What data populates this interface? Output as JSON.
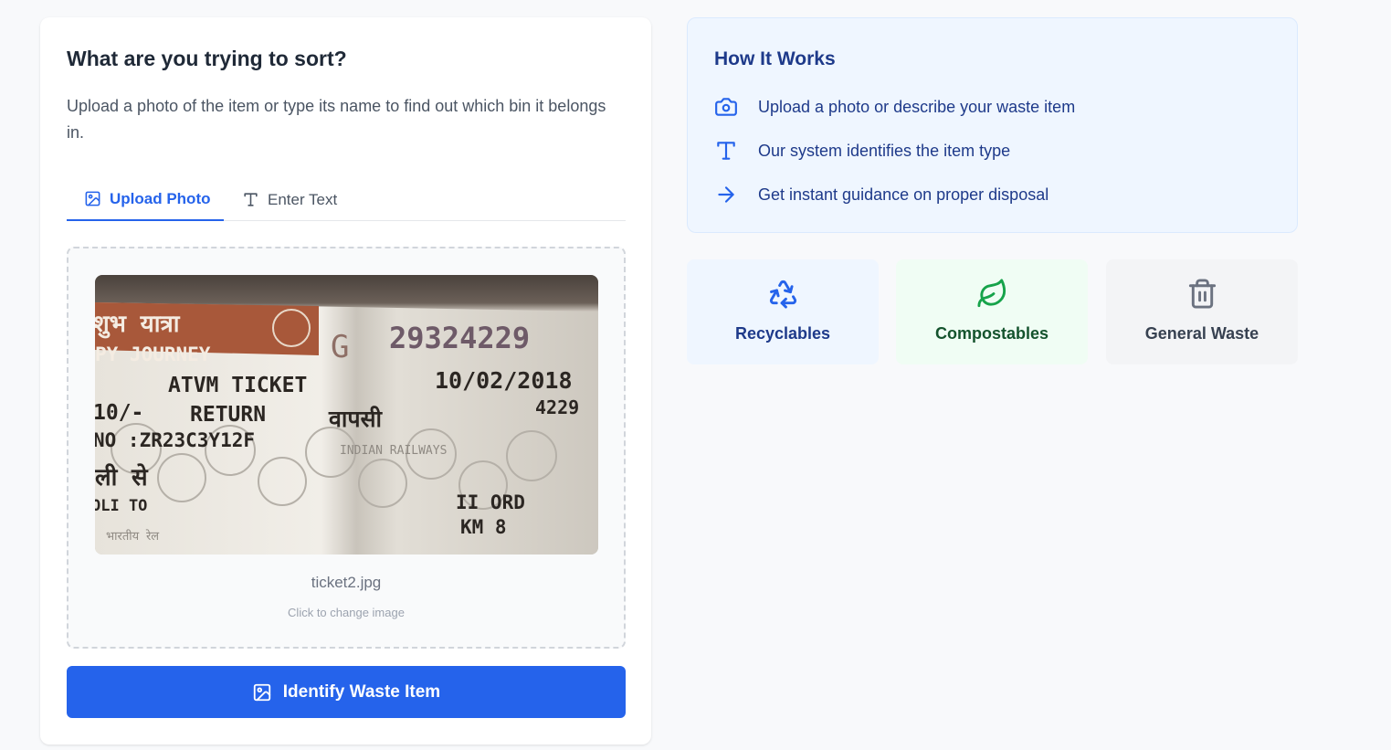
{
  "sorter": {
    "title": "What are you trying to sort?",
    "description": "Upload a photo of the item or type its name to find out which bin it belongs in.",
    "tabs": [
      {
        "label": "Upload Photo",
        "icon": "image-icon",
        "active": true
      },
      {
        "label": "Enter Text",
        "icon": "text-icon",
        "active": false
      }
    ],
    "upload": {
      "file_name": "ticket2.jpg",
      "hint": "Click to change image",
      "photo_text": {
        "line1_hindi": "शुभ यात्रा",
        "line1_english": "PY JOURNEY",
        "series": "G",
        "number": "29324229",
        "ticket_type": "ATVM TICKET",
        "date": "10/02/2018",
        "fare": "10/-",
        "journey": "RETURN",
        "journey_hindi": "वापसी",
        "code": "4229",
        "ticket_no": "NO :ZR23C3Y12F",
        "railways": "INDIAN RAILWAYS",
        "from_hindi": "ली से",
        "from": "OLI TO",
        "cls": "II ORD",
        "km": "KM 8",
        "watermark": "भारतीय रेल"
      }
    },
    "action_label": "Identify Waste Item",
    "accent_color": "#2563eb"
  },
  "how_it_works": {
    "title": "How It Works",
    "steps": [
      {
        "icon": "camera-icon",
        "text": "Upload a photo or describe your waste item"
      },
      {
        "icon": "text-icon",
        "text": "Our system identifies the item type"
      },
      {
        "icon": "arrow-right-icon",
        "text": "Get instant guidance on proper disposal"
      }
    ]
  },
  "bins": [
    {
      "icon": "recycle-icon",
      "label": "Recyclables",
      "color": "#2563eb"
    },
    {
      "icon": "leaf-icon",
      "label": "Compostables",
      "color": "#16a34a"
    },
    {
      "icon": "trash-icon",
      "label": "General Waste",
      "color": "#6b7280"
    }
  ]
}
